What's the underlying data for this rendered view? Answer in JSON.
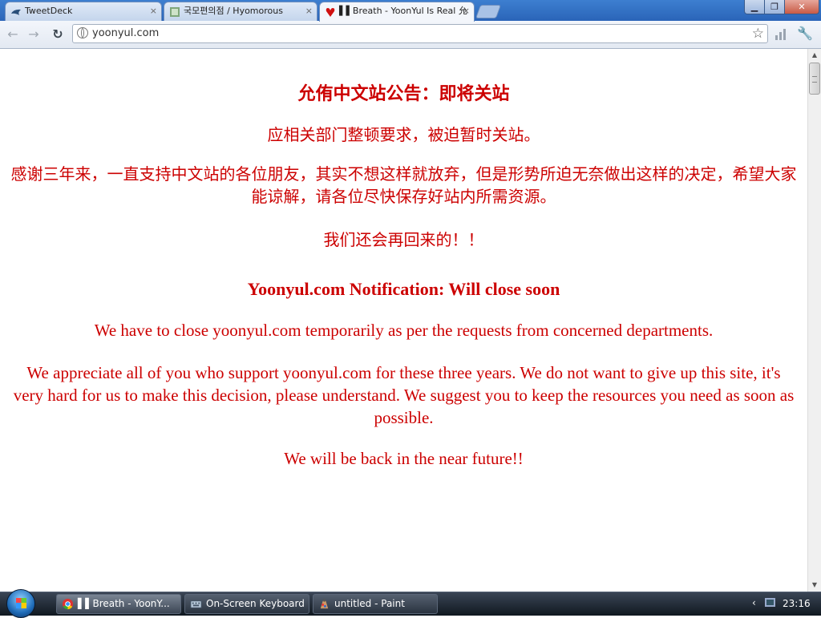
{
  "browser": {
    "tabs": [
      {
        "title": "TweetDeck",
        "icon": "tweetdeck-icon"
      },
      {
        "title": "국모편의점 / Hyomorous",
        "icon": "site-favicon"
      },
      {
        "title": "▌▌Breath - YoonYul Is Real 允",
        "icon": "yoonyul-favicon"
      }
    ],
    "tab_close": "×",
    "url": "yoonyul.com",
    "window_buttons": {
      "minimize": "▁",
      "maximize": "❐",
      "close": "✕"
    },
    "nav": {
      "back": "←",
      "forward": "→",
      "reload": "↻",
      "star": "☆",
      "wrench": "🔧"
    }
  },
  "page": {
    "cn_title": "允侑中文站公告：即将关站",
    "cn_p1": "应相关部门整顿要求，被迫暂时关站。",
    "cn_p2": "感谢三年来，一直支持中文站的各位朋友，其实不想这样就放弃，但是形势所迫无奈做出这样的决定，希望大家能谅解，请各位尽快保存好站内所需资源。",
    "cn_p3": "我们还会再回来的！！",
    "en_title": "Yoonyul.com Notification: Will close soon",
    "en_p1": "We have to close yoonyul.com temporarily as per the requests from concerned departments.",
    "en_p2": "We appreciate all of you who support yoonyul.com for these three years. We do not want to give up this site, it's very hard for us to make this decision, please understand. We suggest you to keep the resources you need as soon as possible.",
    "en_p3": "We will be back in the near future!!",
    "text_color": "#cc0000"
  },
  "scrollbar": {
    "up": "▲",
    "down": "▼"
  },
  "taskbar": {
    "items": [
      {
        "label": "▌▌Breath - YoonY...",
        "icon": "chrome-icon"
      },
      {
        "label": "On-Screen Keyboard",
        "icon": "keyboard-icon"
      },
      {
        "label": "untitled - Paint",
        "icon": "paint-icon"
      }
    ],
    "tray_chevron": "‹",
    "clock": "23:16"
  }
}
